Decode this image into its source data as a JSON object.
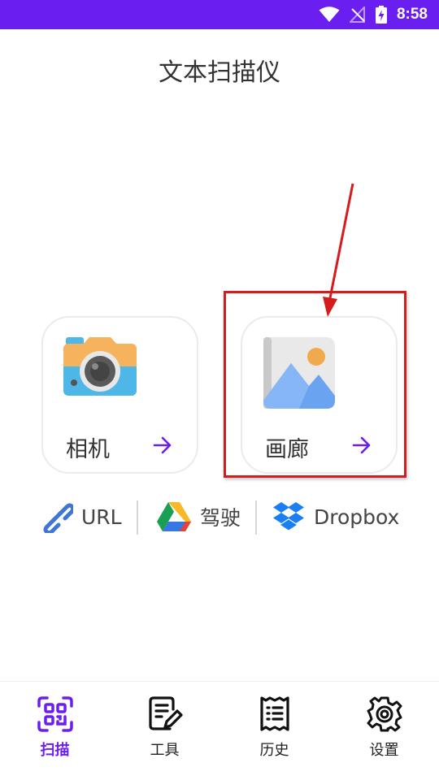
{
  "status_bar": {
    "time": "8:58",
    "background": "#6a1ff0"
  },
  "header": {
    "title": "文本扫描仪"
  },
  "cards": [
    {
      "label": "相机",
      "icon": "camera-icon"
    },
    {
      "label": "画廊",
      "icon": "gallery-image-icon"
    }
  ],
  "sources": [
    {
      "label": "URL",
      "icon": "link-icon"
    },
    {
      "label": "驾驶",
      "icon": "google-drive-icon"
    },
    {
      "label": "Dropbox",
      "icon": "dropbox-icon"
    }
  ],
  "nav": [
    {
      "label": "扫描",
      "icon": "qr-scan-icon",
      "active": true
    },
    {
      "label": "工具",
      "icon": "tools-edit-icon",
      "active": false
    },
    {
      "label": "历史",
      "icon": "history-list-icon",
      "active": false
    },
    {
      "label": "设置",
      "icon": "gear-icon",
      "active": false
    }
  ],
  "colors": {
    "accent": "#6a1ff0",
    "annotation": "#d41c1c"
  }
}
